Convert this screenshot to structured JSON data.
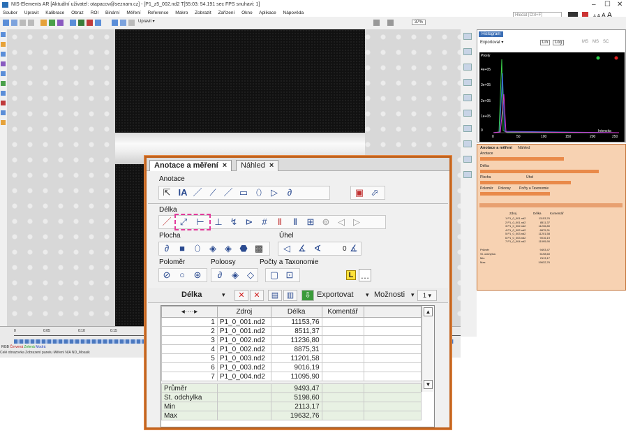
{
  "window": {
    "title": "NIS-Elements AR [Aktuální uživatel: otapacov@seznam.cz] - [P1_z5_002.nd2 T[55:03: 54.191 sec  FPS snuhavi: 1]",
    "minimize": "–",
    "maximize": "☐",
    "close": "✕"
  },
  "menu": [
    "Soubor",
    "Upravit",
    "Kalibrace",
    "Obraz",
    "ROI",
    "Binární",
    "Měření",
    "Reference",
    "Makro",
    "Zobrazit",
    "Zařízení",
    "Okno",
    "Aplikace",
    "Nápověda"
  ],
  "search": {
    "placeholder": "Hledat [Ctrl+F]"
  },
  "font_size_controls": [
    "A",
    "A",
    "A",
    "A"
  ],
  "toolbar2": {
    "upravit": "Upravit ▾",
    "zoom": "37%"
  },
  "histogram": {
    "tab": "Histogram",
    "export": "Exportovat ▾",
    "btn_lin": "Lin",
    "btn_log": "Log",
    "modes": [
      "MS",
      "MS",
      "SC"
    ],
    "ylabels": [
      "4e+05",
      "3e+05",
      "2e+05",
      "1e+05",
      "0"
    ],
    "xlabels": [
      "0",
      "50",
      "100",
      "150",
      "200",
      "250"
    ],
    "xaxis": "Intenzita",
    "pixel_label": "Pixely"
  },
  "orange_panel": {
    "title": "Anotace a měření",
    "preview_tab": "Náhled",
    "labels": [
      "Anotace",
      "Délka",
      "Plocha",
      "Úhel",
      "Poloměr",
      "Poloosy",
      "Počty a Taxonomie"
    ],
    "table_header": [
      "Zdroj",
      "Délka",
      "Komentář"
    ],
    "rows": [
      {
        "n": 1,
        "src": "P1_0_001.nd2",
        "val": "11153,76"
      },
      {
        "n": 2,
        "src": "P1_0_001.nd2",
        "val": "8511,37"
      },
      {
        "n": 3,
        "src": "P1_0_002.nd2",
        "val": "11236,80"
      },
      {
        "n": 4,
        "src": "P1_0_002.nd2",
        "val": "8875,31"
      },
      {
        "n": 5,
        "src": "P1_0_003.nd2",
        "val": "11201,58"
      },
      {
        "n": 6,
        "src": "P1_0_003.nd2",
        "val": "9016,19"
      },
      {
        "n": 7,
        "src": "P1_0_004.nd2",
        "val": "11095,90"
      }
    ],
    "stats": [
      {
        "label": "Průměr",
        "val": "9493,47"
      },
      {
        "label": "St. odchylka",
        "val": "5198,60"
      },
      {
        "label": "Min",
        "val": "2113,17"
      },
      {
        "label": "Max",
        "val": "19632,76"
      }
    ]
  },
  "bottom": {
    "ticks": [
      "0",
      "0:05",
      "0:10",
      "0:15"
    ],
    "legend": [
      "RGB",
      "Červená",
      "Zelená",
      "Modrá"
    ],
    "status": [
      "Celé obrazovka",
      "Zobrazení panelu",
      "Měření",
      "N/A",
      "ND_Mosaik"
    ]
  },
  "dialog": {
    "tab_main": "Anotace a měření",
    "tab_preview": "Náhled",
    "close_glyph": "×",
    "sections": {
      "anotace": "Anotace",
      "delka": "Délka",
      "plocha": "Plocha",
      "uhel": "Úhel",
      "polomer": "Poloměr",
      "poloosy": "Poloosy",
      "pocty": "Počty a Taxonomie"
    },
    "anotace_text_tool": "IA",
    "uhel_count": "0",
    "toolbar": {
      "measure_label": "Délka",
      "export_label": "Exportovat",
      "options_label": "Možnosti",
      "page": "1"
    },
    "table": {
      "columns": [
        "◂····▸",
        "Zdroj",
        "Délka",
        "Komentář"
      ],
      "rows": [
        {
          "n": "1",
          "src": "P1_0_001.nd2",
          "val": "11153,76",
          "comment": ""
        },
        {
          "n": "2",
          "src": "P1_0_001.nd2",
          "val": "8511,37",
          "comment": ""
        },
        {
          "n": "3",
          "src": "P1_0_002.nd2",
          "val": "11236,80",
          "comment": ""
        },
        {
          "n": "4",
          "src": "P1_0_002.nd2",
          "val": "8875,31",
          "comment": ""
        },
        {
          "n": "5",
          "src": "P1_0_003.nd2",
          "val": "11201,58",
          "comment": ""
        },
        {
          "n": "6",
          "src": "P1_0_003.nd2",
          "val": "9016,19",
          "comment": ""
        },
        {
          "n": "7",
          "src": "P1_0_004.nd2",
          "val": "11095,90",
          "comment": ""
        }
      ],
      "stats": [
        {
          "label": "Průměr",
          "val": "9493,47"
        },
        {
          "label": "St. odchylka",
          "val": "5198,60"
        },
        {
          "label": "Min",
          "val": "2113,17"
        },
        {
          "label": "Max",
          "val": "19632,76"
        }
      ]
    }
  },
  "colors": {
    "accent": "#c2641f",
    "highlight": "#e23a9b",
    "panel_orange": "#f7d2b2"
  }
}
